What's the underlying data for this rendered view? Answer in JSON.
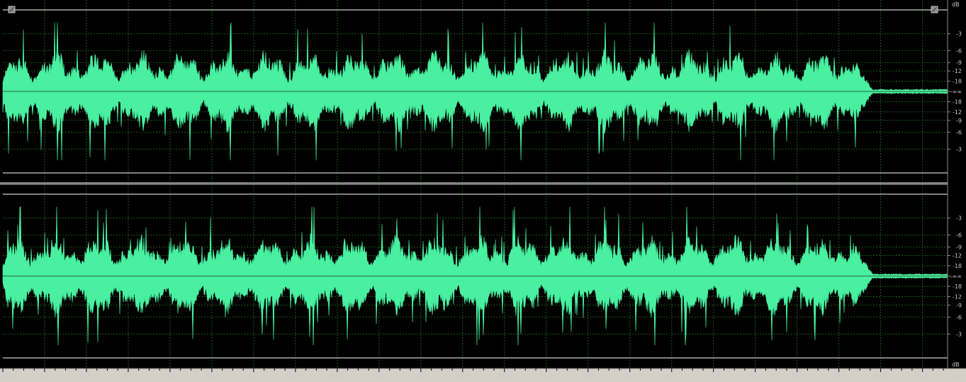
{
  "colors": {
    "background": "#000000",
    "waveform": "#48f0a0",
    "grid": "#1d5a1d",
    "boundary": "#ffffff",
    "ruler_bg": "#d4d0c8",
    "ruler_text": "#000000",
    "scale_text": "#c8c8c8"
  },
  "icons": {
    "left_marker": "in-point-handle-icon",
    "right_marker": "out-point-handle-icon"
  },
  "db_scale": {
    "unit_top": "dB",
    "unit_bottom": "dB",
    "channel_labels": [
      "-3",
      "-6",
      "-9",
      "-12",
      "-18",
      "-∞∞",
      "-18",
      "-12",
      "-9",
      "-6",
      "-3"
    ],
    "channel_levels_db": [
      -3,
      -6,
      -9,
      -12,
      -18,
      null,
      -18,
      -12,
      -9,
      -6,
      -3
    ]
  },
  "time_ruler": {
    "unit_left": "hms",
    "unit_right": "hms",
    "ticks": [
      "2.0",
      "4.0",
      "6.0",
      "8.0",
      "10.0",
      "12.0",
      "14.0",
      "16.0",
      "18.0",
      "20.0",
      "22.0",
      "24.0",
      "26.0",
      "28.0",
      "30.0",
      "32.0",
      "34.0",
      "36.0",
      "38.0",
      "40.0",
      "42.0",
      "44.0"
    ],
    "tick_seconds": [
      2,
      4,
      6,
      8,
      10,
      12,
      14,
      16,
      18,
      20,
      22,
      24,
      26,
      28,
      30,
      32,
      34,
      36,
      38,
      40,
      42,
      44
    ],
    "view_start_seconds": 0,
    "view_end_seconds": 45.2
  },
  "audio": {
    "channels": 2,
    "music_end_seconds": 40.8,
    "fade_end_seconds": 41.6
  }
}
